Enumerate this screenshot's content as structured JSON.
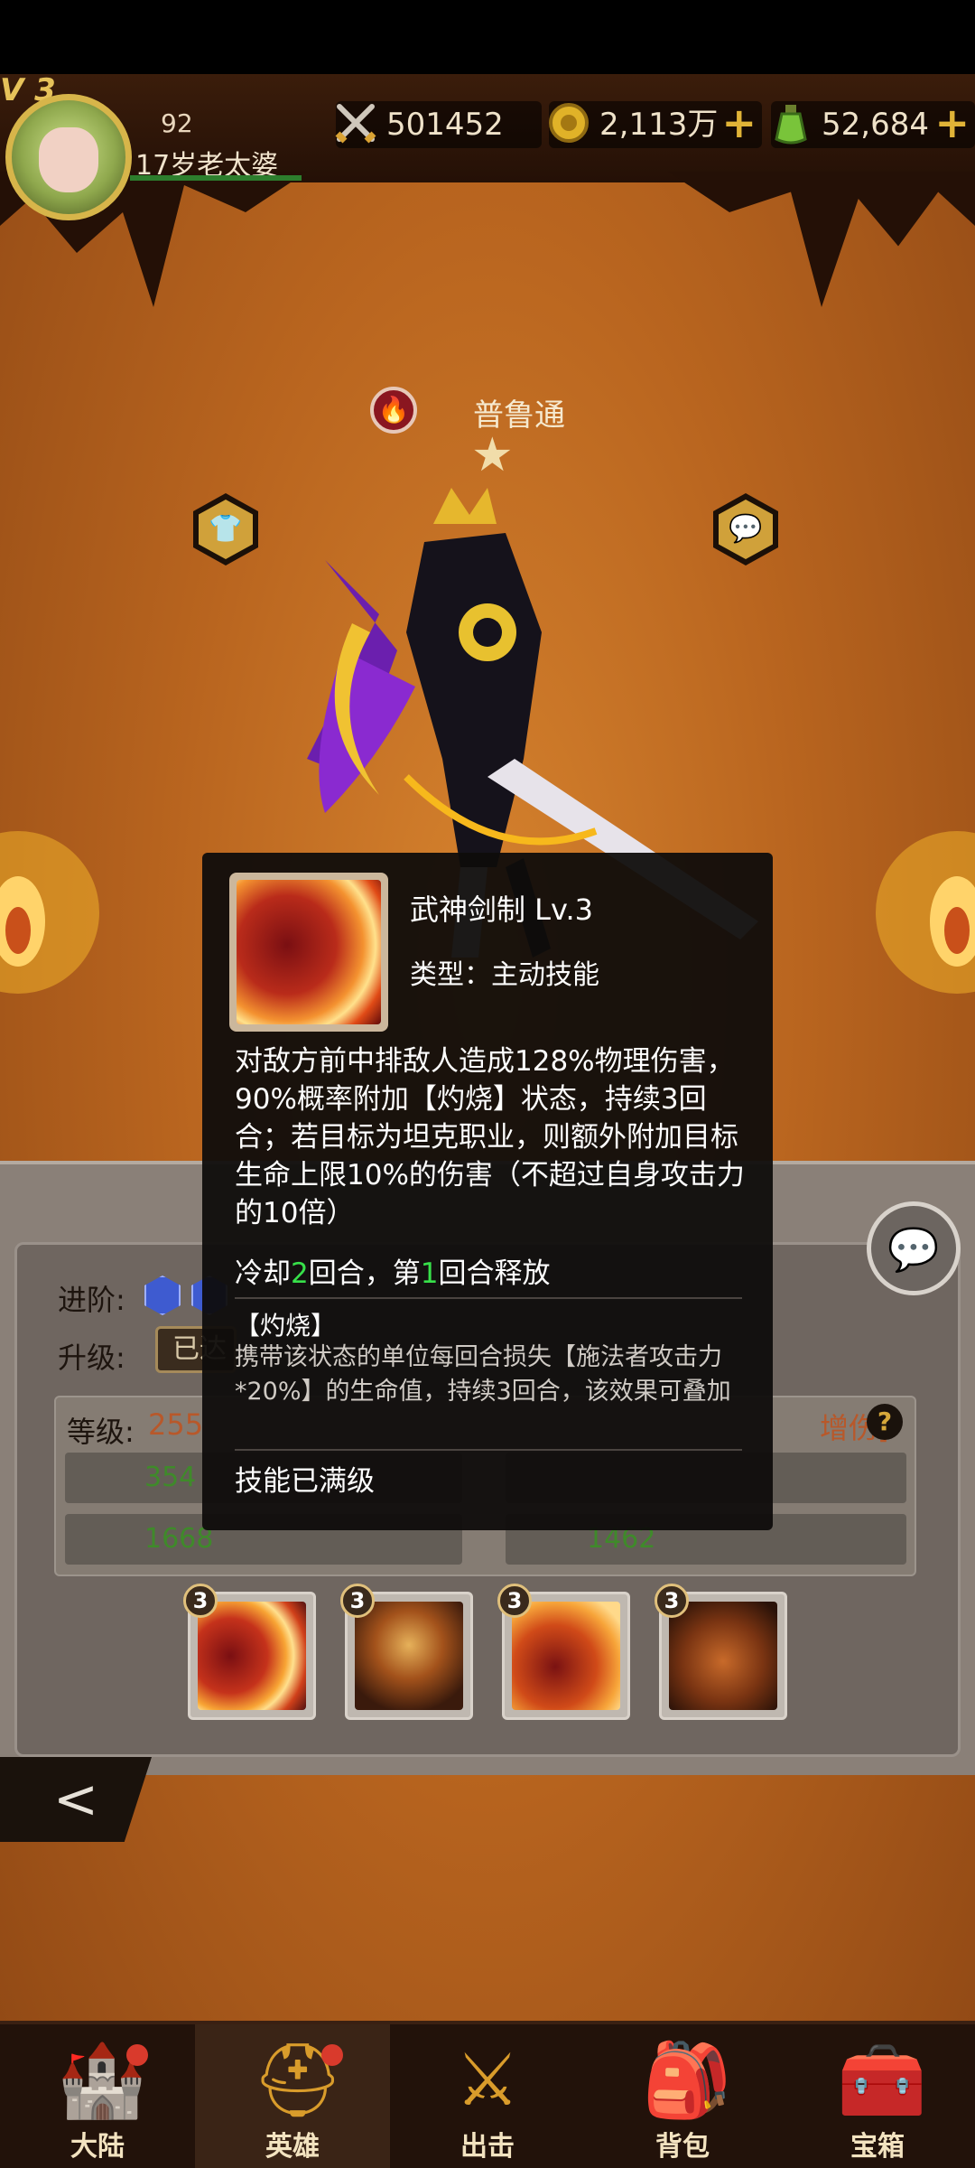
{
  "player": {
    "level_label": "V 3",
    "power": "92",
    "name": "17岁老太婆"
  },
  "resources": [
    {
      "icon": "crossed-swords-icon",
      "value": "501452",
      "has_plus": false
    },
    {
      "icon": "gold-coin-icon",
      "value": "2,113万",
      "has_plus": true
    },
    {
      "icon": "green-potion-icon",
      "value": "52,684",
      "has_plus": true
    }
  ],
  "hero": {
    "name": "普鲁通",
    "stars": 1
  },
  "panel": {
    "advance_label": "进阶:",
    "upgrade_label": "升级:",
    "upgrade_btn": "已达",
    "level_label": "等级:",
    "level_value": "255",
    "skill_damage_label": "增伤]",
    "stats": [
      "354",
      "1668",
      "1462"
    ]
  },
  "skills": [
    {
      "level": "3",
      "name": "sword-slash"
    },
    {
      "level": "3",
      "name": "dark-warrior"
    },
    {
      "level": "3",
      "name": "flame-claw"
    },
    {
      "level": "3",
      "name": "fire-golem"
    }
  ],
  "tooltip": {
    "title": "武神剑制  Lv.3",
    "type": "类型：主动技能",
    "description": "对敌方前中排敌人造成128%物理伤害，90%概率附加【灼烧】状态，持续3回合；若目标为坦克职业，则额外附加目标生命上限10%的伤害（不超过自身攻击力的10倍）",
    "cooldown_prefix": "冷却",
    "cooldown_value": "2",
    "cooldown_mid": "回合，第",
    "cooldown_round": "1",
    "cooldown_suffix": "回合释放",
    "burn_title": "【灼烧】",
    "burn_desc": "携带该状态的单位每回合损失【施法者攻击力*20%】的生命值，持续3回合，该效果可叠加",
    "max_level": "技能已满级"
  },
  "nav": [
    {
      "label": "大陆",
      "icon": "castle-icon",
      "dot": true
    },
    {
      "label": "英雄",
      "icon": "helmet-icon",
      "dot": true,
      "active": true
    },
    {
      "label": "出击",
      "icon": "crossed-swords-icon",
      "dot": false
    },
    {
      "label": "背包",
      "icon": "backpack-icon",
      "dot": false
    },
    {
      "label": "宝箱",
      "icon": "treasure-chest-icon",
      "dot": false
    }
  ],
  "colors": {
    "accent_gold": "#d99c2b",
    "highlight_green": "#37e14a",
    "badge_red": "#d93a2c"
  }
}
